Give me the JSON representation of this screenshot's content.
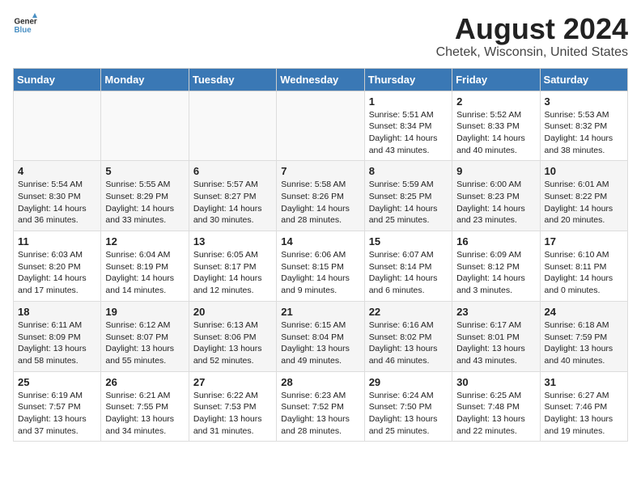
{
  "logo": {
    "line1": "General",
    "line2": "Blue"
  },
  "title": "August 2024",
  "subtitle": "Chetek, Wisconsin, United States",
  "days_header": [
    "Sunday",
    "Monday",
    "Tuesday",
    "Wednesday",
    "Thursday",
    "Friday",
    "Saturday"
  ],
  "weeks": [
    [
      {
        "day": "",
        "content": ""
      },
      {
        "day": "",
        "content": ""
      },
      {
        "day": "",
        "content": ""
      },
      {
        "day": "",
        "content": ""
      },
      {
        "day": "1",
        "content": "Sunrise: 5:51 AM\nSunset: 8:34 PM\nDaylight: 14 hours\nand 43 minutes."
      },
      {
        "day": "2",
        "content": "Sunrise: 5:52 AM\nSunset: 8:33 PM\nDaylight: 14 hours\nand 40 minutes."
      },
      {
        "day": "3",
        "content": "Sunrise: 5:53 AM\nSunset: 8:32 PM\nDaylight: 14 hours\nand 38 minutes."
      }
    ],
    [
      {
        "day": "4",
        "content": "Sunrise: 5:54 AM\nSunset: 8:30 PM\nDaylight: 14 hours\nand 36 minutes."
      },
      {
        "day": "5",
        "content": "Sunrise: 5:55 AM\nSunset: 8:29 PM\nDaylight: 14 hours\nand 33 minutes."
      },
      {
        "day": "6",
        "content": "Sunrise: 5:57 AM\nSunset: 8:27 PM\nDaylight: 14 hours\nand 30 minutes."
      },
      {
        "day": "7",
        "content": "Sunrise: 5:58 AM\nSunset: 8:26 PM\nDaylight: 14 hours\nand 28 minutes."
      },
      {
        "day": "8",
        "content": "Sunrise: 5:59 AM\nSunset: 8:25 PM\nDaylight: 14 hours\nand 25 minutes."
      },
      {
        "day": "9",
        "content": "Sunrise: 6:00 AM\nSunset: 8:23 PM\nDaylight: 14 hours\nand 23 minutes."
      },
      {
        "day": "10",
        "content": "Sunrise: 6:01 AM\nSunset: 8:22 PM\nDaylight: 14 hours\nand 20 minutes."
      }
    ],
    [
      {
        "day": "11",
        "content": "Sunrise: 6:03 AM\nSunset: 8:20 PM\nDaylight: 14 hours\nand 17 minutes."
      },
      {
        "day": "12",
        "content": "Sunrise: 6:04 AM\nSunset: 8:19 PM\nDaylight: 14 hours\nand 14 minutes."
      },
      {
        "day": "13",
        "content": "Sunrise: 6:05 AM\nSunset: 8:17 PM\nDaylight: 14 hours\nand 12 minutes."
      },
      {
        "day": "14",
        "content": "Sunrise: 6:06 AM\nSunset: 8:15 PM\nDaylight: 14 hours\nand 9 minutes."
      },
      {
        "day": "15",
        "content": "Sunrise: 6:07 AM\nSunset: 8:14 PM\nDaylight: 14 hours\nand 6 minutes."
      },
      {
        "day": "16",
        "content": "Sunrise: 6:09 AM\nSunset: 8:12 PM\nDaylight: 14 hours\nand 3 minutes."
      },
      {
        "day": "17",
        "content": "Sunrise: 6:10 AM\nSunset: 8:11 PM\nDaylight: 14 hours\nand 0 minutes."
      }
    ],
    [
      {
        "day": "18",
        "content": "Sunrise: 6:11 AM\nSunset: 8:09 PM\nDaylight: 13 hours\nand 58 minutes."
      },
      {
        "day": "19",
        "content": "Sunrise: 6:12 AM\nSunset: 8:07 PM\nDaylight: 13 hours\nand 55 minutes."
      },
      {
        "day": "20",
        "content": "Sunrise: 6:13 AM\nSunset: 8:06 PM\nDaylight: 13 hours\nand 52 minutes."
      },
      {
        "day": "21",
        "content": "Sunrise: 6:15 AM\nSunset: 8:04 PM\nDaylight: 13 hours\nand 49 minutes."
      },
      {
        "day": "22",
        "content": "Sunrise: 6:16 AM\nSunset: 8:02 PM\nDaylight: 13 hours\nand 46 minutes."
      },
      {
        "day": "23",
        "content": "Sunrise: 6:17 AM\nSunset: 8:01 PM\nDaylight: 13 hours\nand 43 minutes."
      },
      {
        "day": "24",
        "content": "Sunrise: 6:18 AM\nSunset: 7:59 PM\nDaylight: 13 hours\nand 40 minutes."
      }
    ],
    [
      {
        "day": "25",
        "content": "Sunrise: 6:19 AM\nSunset: 7:57 PM\nDaylight: 13 hours\nand 37 minutes."
      },
      {
        "day": "26",
        "content": "Sunrise: 6:21 AM\nSunset: 7:55 PM\nDaylight: 13 hours\nand 34 minutes."
      },
      {
        "day": "27",
        "content": "Sunrise: 6:22 AM\nSunset: 7:53 PM\nDaylight: 13 hours\nand 31 minutes."
      },
      {
        "day": "28",
        "content": "Sunrise: 6:23 AM\nSunset: 7:52 PM\nDaylight: 13 hours\nand 28 minutes."
      },
      {
        "day": "29",
        "content": "Sunrise: 6:24 AM\nSunset: 7:50 PM\nDaylight: 13 hours\nand 25 minutes."
      },
      {
        "day": "30",
        "content": "Sunrise: 6:25 AM\nSunset: 7:48 PM\nDaylight: 13 hours\nand 22 minutes."
      },
      {
        "day": "31",
        "content": "Sunrise: 6:27 AM\nSunset: 7:46 PM\nDaylight: 13 hours\nand 19 minutes."
      }
    ]
  ]
}
